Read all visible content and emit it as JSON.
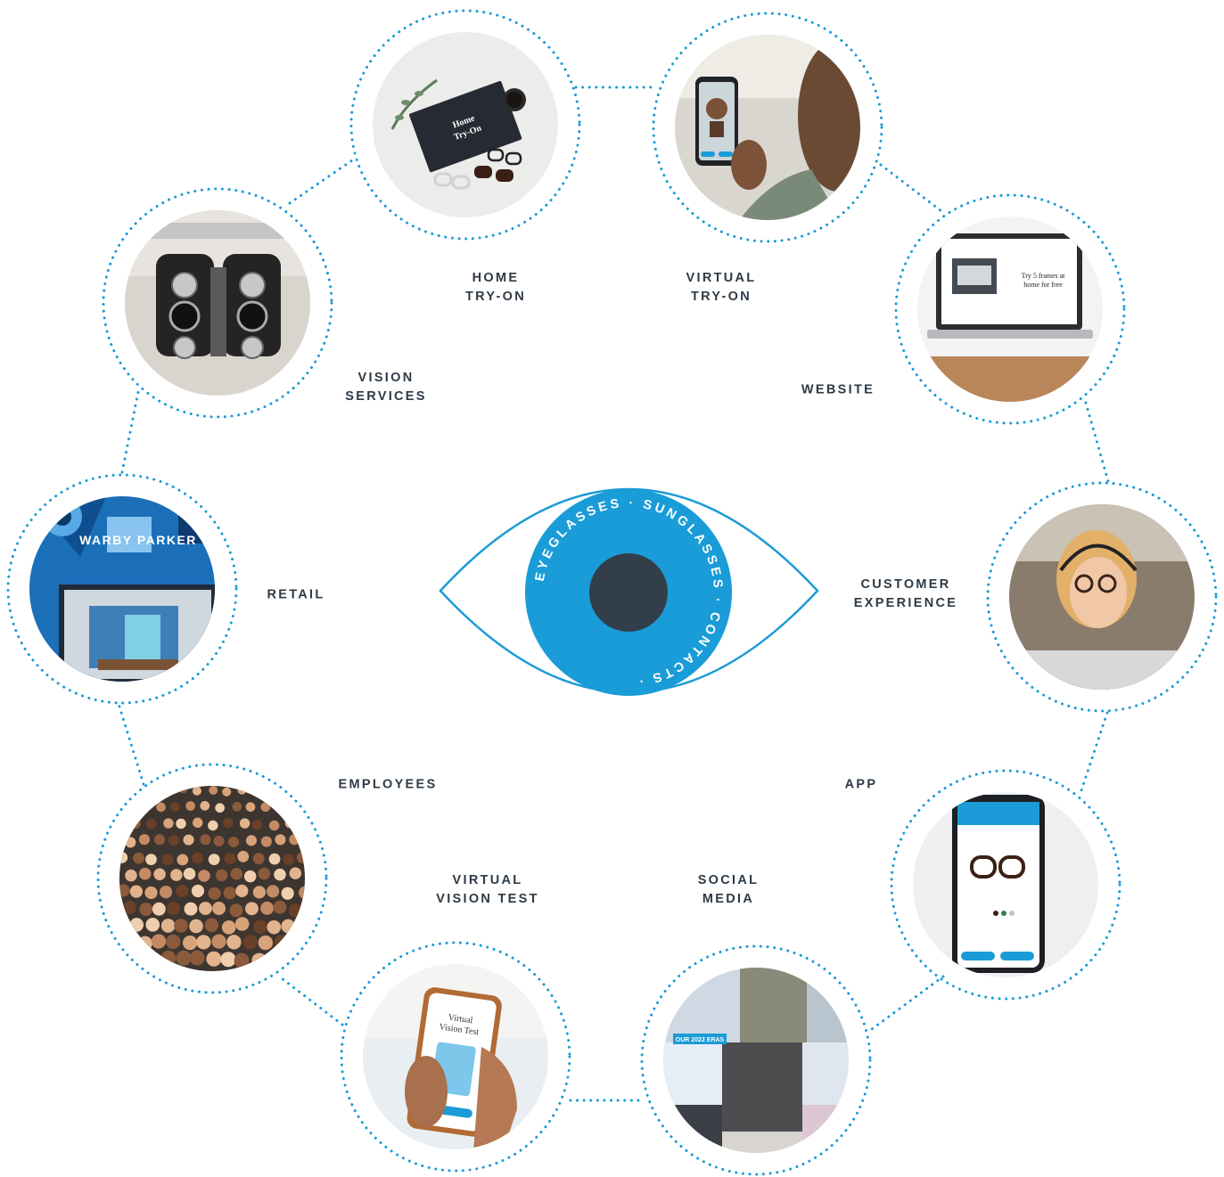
{
  "colors": {
    "dots": "#1b9bd7",
    "eye_outline": "#1b9bd7",
    "iris": "#1a9cd8",
    "pupil": "#323f4b",
    "label_text": "#2e3a45",
    "ring_text": "#ffffff"
  },
  "center": {
    "ring_words": [
      "EYEGLASSES",
      "SUNGLASSES",
      "CONTACTS"
    ],
    "separator": "·"
  },
  "nodes": [
    {
      "id": "home-try-on",
      "label_lines": [
        "HOME",
        "TRY-ON"
      ],
      "image_desc": "home-try-on-box-photo"
    },
    {
      "id": "virtual-try-on",
      "label_lines": [
        "VIRTUAL",
        "TRY-ON"
      ],
      "image_desc": "phone-virtual-try-on-photo"
    },
    {
      "id": "website",
      "label_lines": [
        "WEBSITE"
      ],
      "image_desc": "laptop-website-photo"
    },
    {
      "id": "customer-experience",
      "label_lines": [
        "CUSTOMER",
        "EXPERIENCE"
      ],
      "image_desc": "customer-agent-headset-photo"
    },
    {
      "id": "app",
      "label_lines": [
        "APP"
      ],
      "image_desc": "phone-app-glasses-photo"
    },
    {
      "id": "social-media",
      "label_lines": [
        "SOCIAL",
        "MEDIA"
      ],
      "image_desc": "social-media-collage-photo"
    },
    {
      "id": "virtual-vision-test",
      "label_lines": [
        "VIRTUAL",
        "VISION TEST"
      ],
      "image_desc": "phone-vision-test-photo"
    },
    {
      "id": "employees",
      "label_lines": [
        "EMPLOYEES"
      ],
      "image_desc": "employees-group-photo"
    },
    {
      "id": "retail",
      "label_lines": [
        "RETAIL"
      ],
      "image_desc": "retail-store-photo",
      "logo_text": "WARBY PARKER"
    },
    {
      "id": "vision-services",
      "label_lines": [
        "VISION",
        "SERVICES"
      ],
      "image_desc": "phoropter-photo"
    }
  ]
}
